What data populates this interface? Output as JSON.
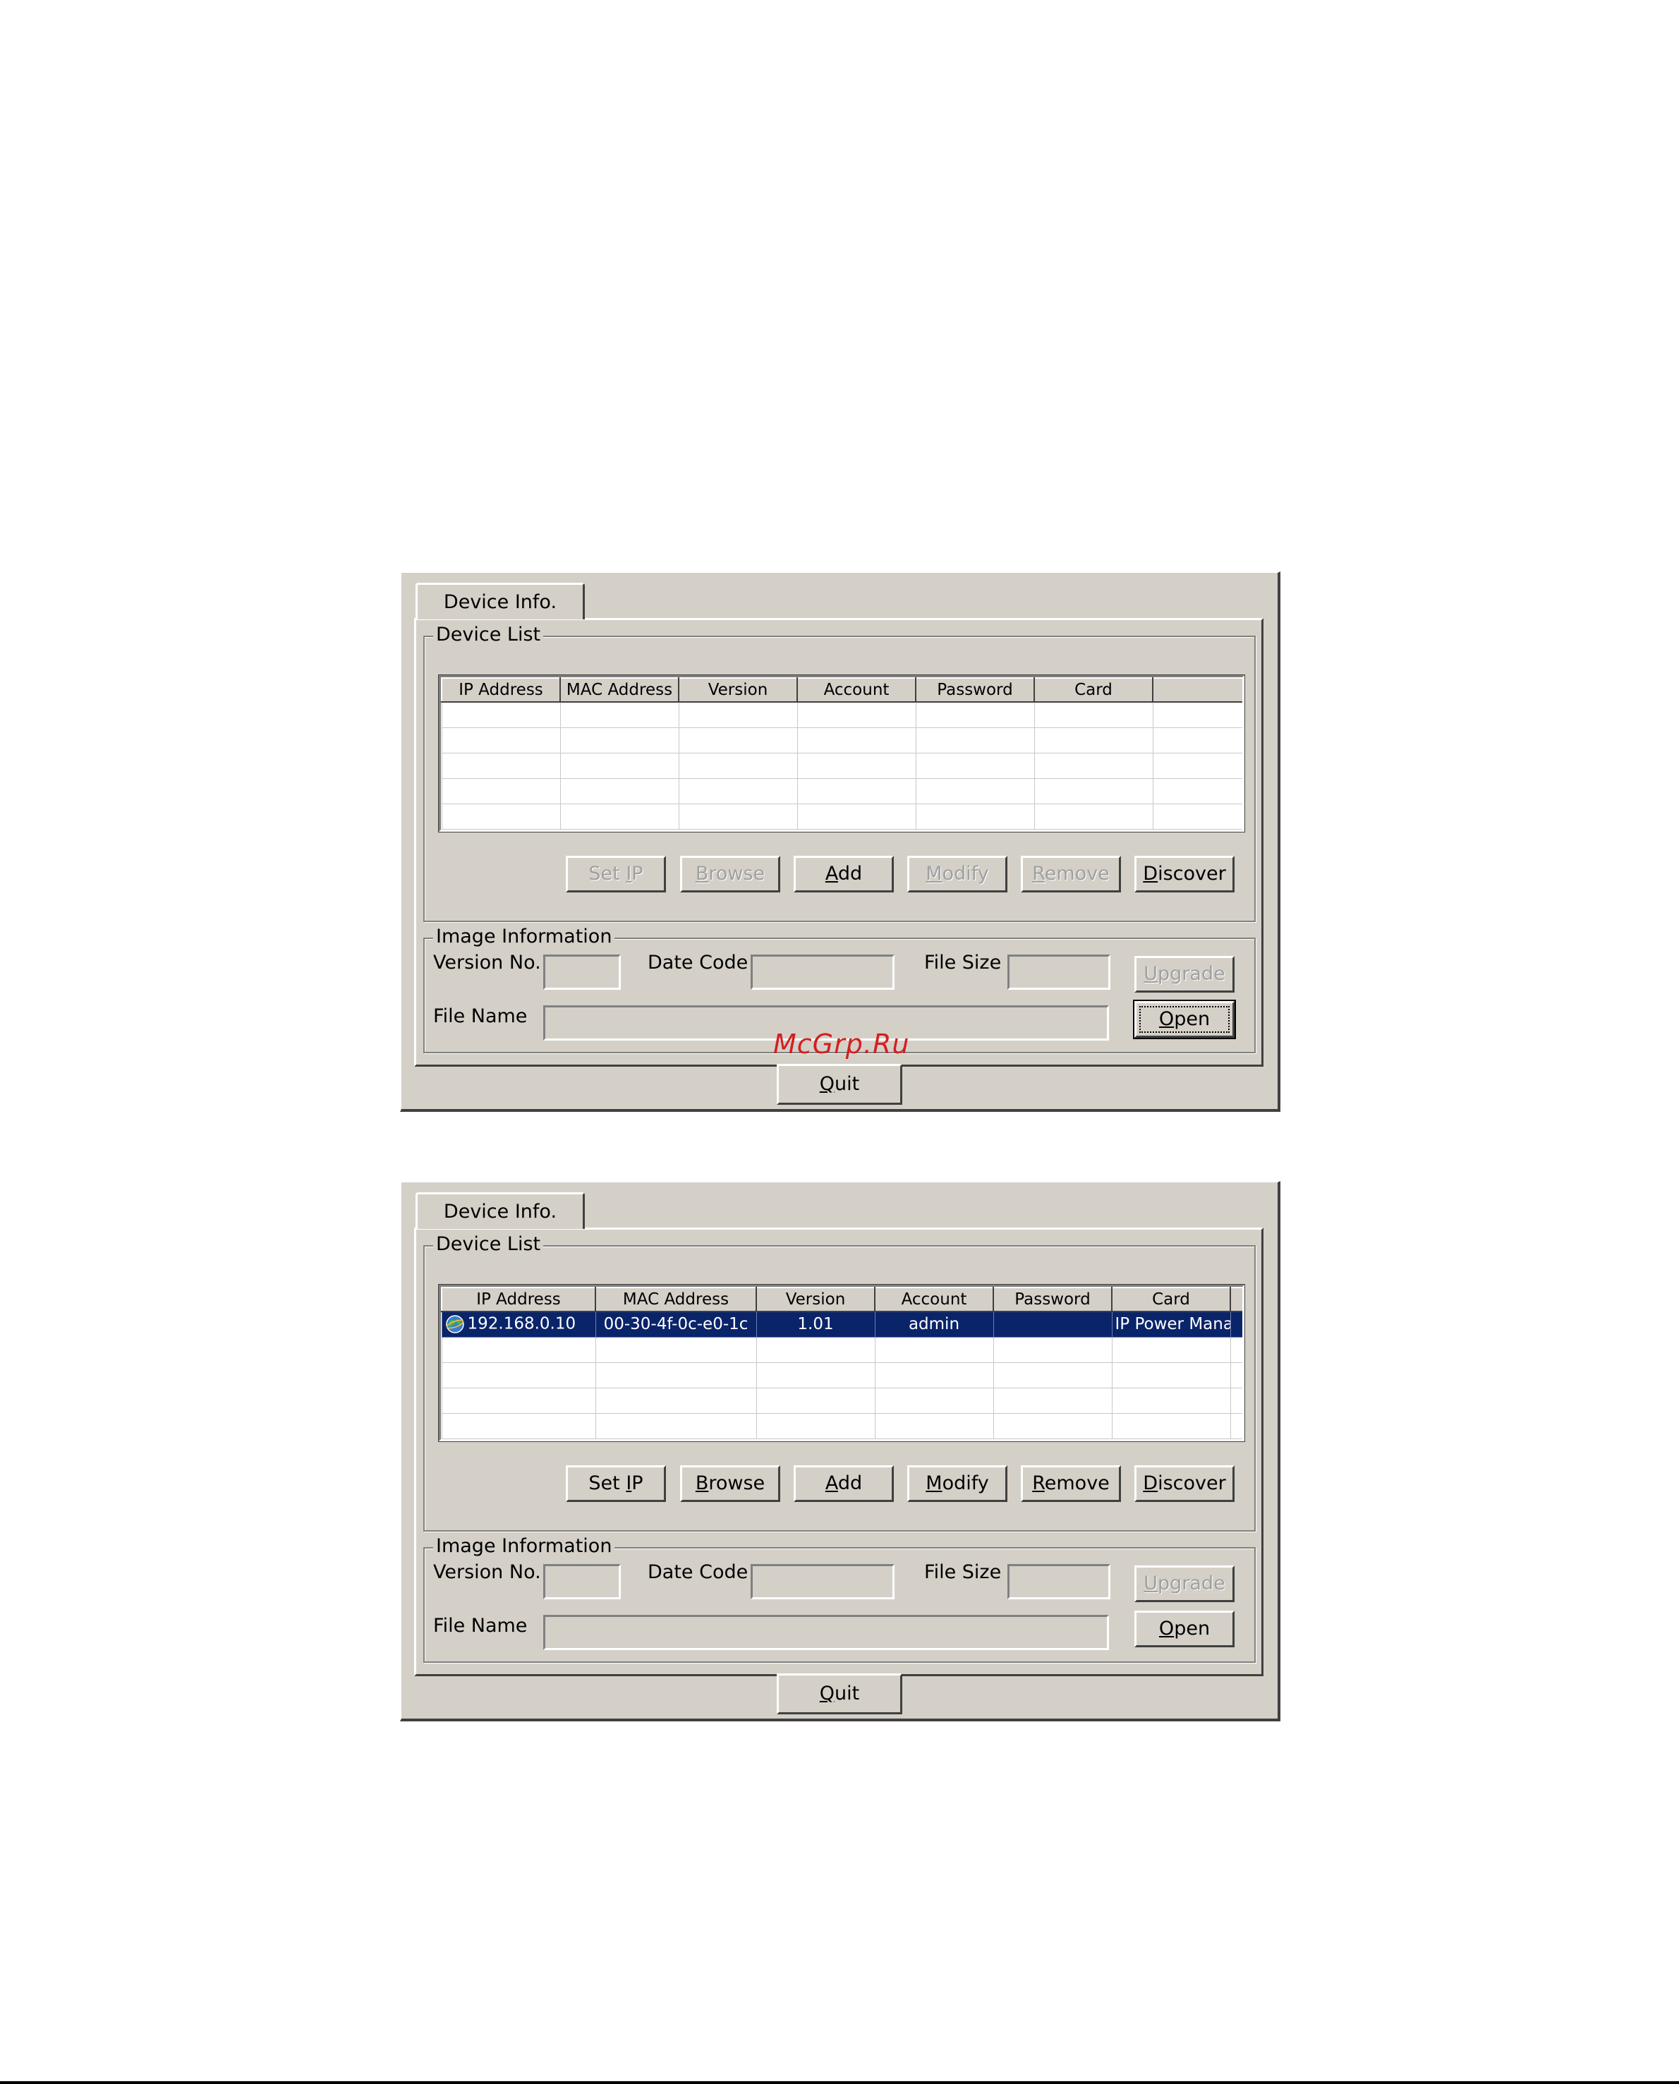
{
  "labels": {
    "tab": "Device Info.",
    "device_list": "Device List",
    "image_information": "Image Information",
    "version_no": "Version No.",
    "date_code": "Date Code",
    "file_size": "File Size",
    "file_name": "File Name"
  },
  "columns": [
    "IP Address",
    "MAC Address",
    "Version",
    "Account",
    "Password",
    "Card"
  ],
  "buttons": {
    "set_ip": {
      "pre": "Set ",
      "key": "I",
      "post": "P"
    },
    "browse": {
      "pre": "",
      "key": "B",
      "post": "rowse"
    },
    "add": {
      "pre": "",
      "key": "A",
      "post": "dd"
    },
    "modify": {
      "pre": "",
      "key": "M",
      "post": "odify"
    },
    "remove": {
      "pre": "",
      "key": "R",
      "post": "emove"
    },
    "discover": {
      "pre": "",
      "key": "D",
      "post": "iscover"
    },
    "upgrade": {
      "pre": "",
      "key": "U",
      "post": "pgrade"
    },
    "open": {
      "pre": "",
      "key": "O",
      "post": "pen"
    },
    "quit": {
      "pre": "",
      "key": "Q",
      "post": "uit"
    }
  },
  "dialog2_row": {
    "ip": "192.168.0.10",
    "mac": "00-30-4f-0c-e0-1c",
    "version": "1.01",
    "account": "admin",
    "password": "",
    "card": "IP Power Manag"
  },
  "watermark": "McGrp.Ru",
  "colors": {
    "face": "#d4d0c8",
    "selection": "#0a246a",
    "watermark": "#d32020"
  },
  "icons": {
    "row_icon": "globe-icon"
  }
}
